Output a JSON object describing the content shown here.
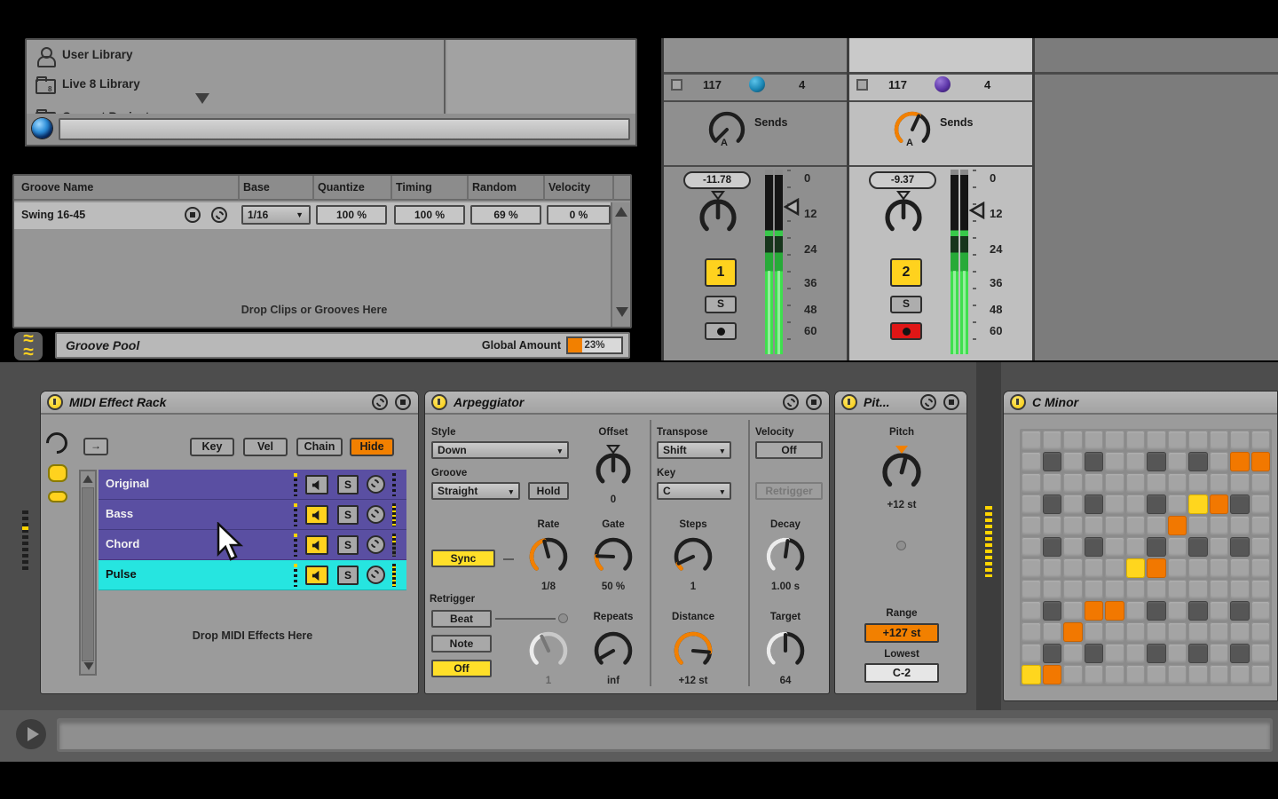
{
  "browser": {
    "items": [
      {
        "label": "User Library"
      },
      {
        "label": "Live 8 Library"
      },
      {
        "label": "Current Project"
      }
    ],
    "search_value": ""
  },
  "groove_pool": {
    "headers": [
      "Groove Name",
      "Base",
      "Quantize",
      "Timing",
      "Random",
      "Velocity"
    ],
    "row": {
      "name": "Swing 16-45",
      "base": "1/16",
      "quantize": "100 %",
      "timing": "100 %",
      "random": "69 %",
      "velocity": "0 %"
    },
    "drop_text": "Drop Clips or Grooves Here",
    "footer": {
      "title": "Groove Pool",
      "amount_label": "Global Amount",
      "amount_value": "23%",
      "amount_pct": 27
    }
  },
  "mixer": {
    "channels": [
      {
        "number": "117",
        "beats": "4",
        "send_label": "Sends",
        "send_knob_letter": "A",
        "value": "-11.78",
        "track": "1",
        "solo": "S"
      },
      {
        "number": "117",
        "beats": "4",
        "send_label": "Sends",
        "send_knob_letter": "A",
        "value": "-9.37",
        "track": "2",
        "solo": "S"
      }
    ],
    "scale": [
      "0",
      "12",
      "24",
      "36",
      "48",
      "60"
    ]
  },
  "rack": {
    "title": "MIDI Effect Rack",
    "map_icon": "→",
    "buttons": {
      "key": "Key",
      "vel": "Vel",
      "chain": "Chain",
      "hide": "Hide"
    },
    "solo_label": "S",
    "chains": [
      {
        "name": "Original",
        "selected": false,
        "speaker_on": false,
        "meter": "dark"
      },
      {
        "name": "Bass",
        "selected": false,
        "speaker_on": true,
        "meter": "full"
      },
      {
        "name": "Chord",
        "selected": false,
        "speaker_on": true,
        "meter": "half"
      },
      {
        "name": "Pulse",
        "selected": true,
        "speaker_on": true,
        "meter": "full"
      }
    ],
    "drop_text": "Drop MIDI Effects Here"
  },
  "arp": {
    "title": "Arpeggiator",
    "style_label": "Style",
    "style_value": "Down",
    "groove_label": "Groove",
    "groove_value": "Straight",
    "hold_label": "Hold",
    "offset_label": "Offset",
    "offset_value": "0",
    "transpose_label": "Transpose",
    "transpose_value": "Shift",
    "key_label": "Key",
    "key_value": "C",
    "velocity_label": "Velocity",
    "velocity_value": "Off",
    "retrigger_button": "Retrigger",
    "sync_label": "Sync",
    "rate_label": "Rate",
    "rate_value": "1/8",
    "gate_label": "Gate",
    "gate_value": "50 %",
    "steps_label": "Steps",
    "steps_value": "1",
    "decay_label": "Decay",
    "decay_value": "1.00 s",
    "retrigger_label": "Retrigger",
    "beat_label": "Beat",
    "note_label": "Note",
    "off_label": "Off",
    "retrig_count_value": "1",
    "repeats_label": "Repeats",
    "repeats_value": "inf",
    "distance_label": "Distance",
    "distance_value": "+12 st",
    "target_label": "Target",
    "target_value": "64"
  },
  "pitch_device": {
    "title": "Pit...",
    "pitch_label": "Pitch",
    "pitch_value": "+12 st",
    "range_label": "Range",
    "range_value": "+127 st",
    "lowest_label": "Lowest",
    "lowest_value": "C-2"
  },
  "scale_device": {
    "title": "C Minor",
    "legend": {
      "0": "empty",
      "1": "dark",
      "2": "mapped-orange",
      "3": "diagonal-yellow"
    },
    "grid": [
      [
        0,
        0,
        0,
        0,
        0,
        0,
        0,
        0,
        0,
        0,
        0,
        0
      ],
      [
        0,
        1,
        0,
        1,
        0,
        0,
        1,
        0,
        1,
        0,
        2,
        2
      ],
      [
        0,
        0,
        0,
        0,
        0,
        0,
        0,
        0,
        0,
        0,
        0,
        0
      ],
      [
        0,
        1,
        0,
        1,
        0,
        0,
        1,
        0,
        3,
        2,
        1,
        0
      ],
      [
        0,
        0,
        0,
        0,
        0,
        0,
        0,
        2,
        0,
        0,
        0,
        0
      ],
      [
        0,
        1,
        0,
        1,
        0,
        0,
        1,
        0,
        1,
        0,
        1,
        0
      ],
      [
        0,
        0,
        0,
        0,
        0,
        3,
        2,
        0,
        0,
        0,
        0,
        0
      ],
      [
        0,
        0,
        0,
        0,
        0,
        0,
        0,
        0,
        0,
        0,
        0,
        0
      ],
      [
        0,
        1,
        0,
        2,
        2,
        0,
        1,
        0,
        1,
        0,
        1,
        0
      ],
      [
        0,
        0,
        2,
        0,
        0,
        0,
        0,
        0,
        0,
        0,
        0,
        0
      ],
      [
        0,
        1,
        0,
        1,
        0,
        0,
        1,
        0,
        1,
        0,
        1,
        0
      ],
      [
        3,
        2,
        0,
        0,
        0,
        0,
        0,
        0,
        0,
        0,
        0,
        0
      ]
    ]
  },
  "knobs": {
    "send1": {
      "a": -135
    },
    "send2": {
      "a": 25,
      "arc": "orange"
    },
    "pan1": {
      "a": 0,
      "t": "b"
    },
    "pan2": {
      "a": 0,
      "t": "b"
    },
    "offset": {
      "a": 0,
      "t": "b"
    },
    "rate": {
      "a": -15,
      "arc": "orange"
    },
    "gate": {
      "a": -88,
      "arc": "orange"
    },
    "steps": {
      "a": -115,
      "arc": "orange"
    },
    "decay": {
      "a": 8,
      "arc": "light"
    },
    "retrig_count": {
      "a": -25,
      "arc": "light",
      "dim": true
    },
    "repeats": {
      "a": -120
    },
    "distance": {
      "a": 95,
      "arc": "orange"
    },
    "target": {
      "a": 0,
      "arc": "light"
    },
    "pitch": {
      "a": 15,
      "t": "o"
    }
  },
  "colors": {
    "accent_orange": "#f28000",
    "ableton_yellow": "#ffd21e",
    "chain_purple": "#5a4fa2",
    "chain_cyan": "#26e5e0",
    "meter_green": "#3fe04e",
    "record_red": "#e01616",
    "track1_circle": "#1b87b5",
    "track2_circle": "#5c35a8"
  }
}
